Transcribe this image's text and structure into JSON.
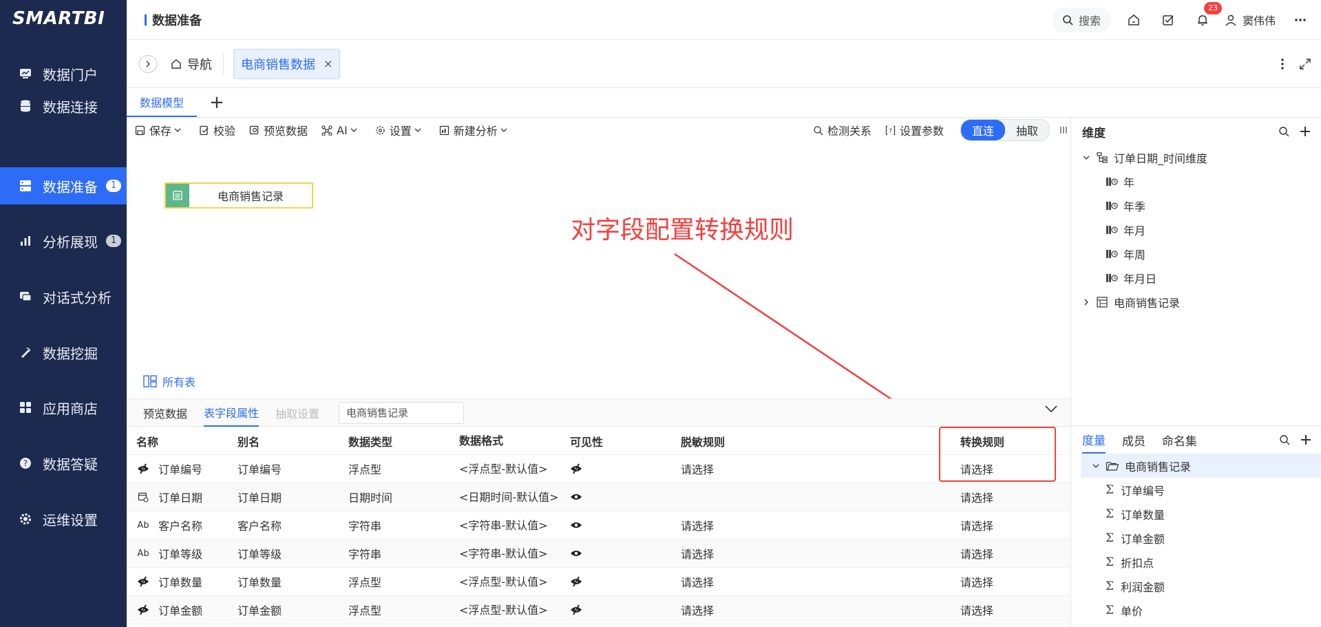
{
  "app": {
    "logo": "SMARTBI"
  },
  "sidebar": {
    "items": [
      {
        "label": "数据门户",
        "badge": ""
      },
      {
        "label": "数据连接",
        "badge": ""
      },
      {
        "label": "数据准备",
        "badge": "1"
      },
      {
        "label": "分析展现",
        "badge": "1"
      },
      {
        "label": "对话式分析",
        "badge": ""
      },
      {
        "label": "数据挖掘",
        "badge": ""
      },
      {
        "label": "应用商店",
        "badge": ""
      },
      {
        "label": "数据答疑",
        "badge": ""
      },
      {
        "label": "运维设置",
        "badge": ""
      }
    ],
    "active_index": 2
  },
  "header": {
    "title": "数据准备",
    "search_label": "搜索",
    "notification_count": "23",
    "user_name": "窦伟伟"
  },
  "tabs": {
    "home_label": "导航",
    "open_tab": "电商销售数据",
    "close_glyph": "×"
  },
  "model_tab": {
    "label": "数据模型",
    "add_glyph": "+"
  },
  "toolbar": {
    "save": "保存",
    "validate": "校验",
    "preview": "预览数据",
    "ai": "AI",
    "settings": "设置",
    "new_analysis": "新建分析",
    "detect_relation": "检测关系",
    "set_params": "设置参数",
    "mode_direct": "直连",
    "mode_extract": "抽取"
  },
  "canvas": {
    "table_node": "电商销售记录",
    "annotation": "对字段配置转换规则",
    "all_tables": "所有表"
  },
  "bottom": {
    "tabs": [
      "预览数据",
      "表字段属性",
      "抽取设置"
    ],
    "table_select": "电商销售记录",
    "columns": [
      "名称",
      "别名",
      "数据类型",
      "数据格式",
      "可见性",
      "脱敏规则",
      "转换规则"
    ],
    "rows": [
      {
        "type_icon": "measure",
        "name": "订单编号",
        "alias": "订单编号",
        "dtype": "浮点型",
        "format": "<浮点型-默认值>",
        "visible": "hidden",
        "mask": "请选择",
        "convert": "请选择"
      },
      {
        "type_icon": "date",
        "name": "订单日期",
        "alias": "订单日期",
        "dtype": "日期时间",
        "format": "<日期时间-默认值>",
        "visible": "visible",
        "mask": "",
        "convert": "请选择"
      },
      {
        "type_icon": "string",
        "name": "客户名称",
        "alias": "客户名称",
        "dtype": "字符串",
        "format": "<字符串-默认值>",
        "visible": "visible",
        "mask": "请选择",
        "convert": "请选择"
      },
      {
        "type_icon": "string",
        "name": "订单等级",
        "alias": "订单等级",
        "dtype": "字符串",
        "format": "<字符串-默认值>",
        "visible": "visible",
        "mask": "请选择",
        "convert": "请选择"
      },
      {
        "type_icon": "measure",
        "name": "订单数量",
        "alias": "订单数量",
        "dtype": "浮点型",
        "format": "<浮点型-默认值>",
        "visible": "hidden",
        "mask": "请选择",
        "convert": "请选择"
      },
      {
        "type_icon": "measure",
        "name": "订单金额",
        "alias": "订单金额",
        "dtype": "浮点型",
        "format": "<浮点型-默认值>",
        "visible": "hidden",
        "mask": "请选择",
        "convert": "请选择"
      }
    ],
    "string_icon_text": "Ab"
  },
  "right": {
    "dim_title": "维度",
    "hierarchy": "订单日期_时间维度",
    "levels": [
      "年",
      "年季",
      "年月",
      "年周",
      "年月日"
    ],
    "dim_table": "电商销售记录",
    "measure_tabs": [
      "度量",
      "成员",
      "命名集"
    ],
    "measure_folder": "电商销售记录",
    "measures": [
      "订单编号",
      "订单数量",
      "订单金额",
      "折扣点",
      "利润金额",
      "单价"
    ],
    "sigma": "Σ"
  },
  "colors": {
    "sidebar_bg": "#1d2a4f",
    "accent": "#2d6cf6",
    "annotation": "#f53f3f",
    "node_border": "#f0d64a",
    "node_icon": "#5cb88a"
  }
}
